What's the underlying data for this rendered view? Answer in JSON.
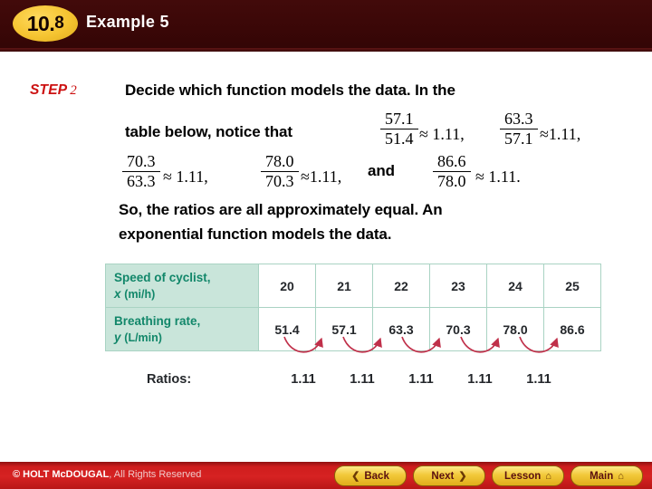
{
  "header": {
    "chapter_major": "10",
    "chapter_dot": ".",
    "chapter_minor": "8",
    "title": "Example 5"
  },
  "step": {
    "label": "STEP",
    "number": "2",
    "line1": "Decide which function models the data. In the",
    "line2": "table below, notice that",
    "and_word": "and",
    "conclusion_line1": "So, the ratios are all approximately equal. An",
    "conclusion_line2": "exponential function models the data."
  },
  "fractions": [
    {
      "id": "A1",
      "numerator": "57.1",
      "denominator": "51.4",
      "approx": "≈ 1.11,"
    },
    {
      "id": "A2",
      "numerator": "63.3",
      "denominator": "57.1",
      "approx": "≈1.11,"
    },
    {
      "id": "B1",
      "numerator": "70.3",
      "denominator": "63.3",
      "approx": "≈ 1.11,"
    },
    {
      "id": "B2",
      "numerator": "78.0",
      "denominator": "70.3",
      "approx": "≈1.11,"
    },
    {
      "id": "B3",
      "numerator": "86.6",
      "denominator": "78.0",
      "approx": "≈ 1.11."
    }
  ],
  "chart_data": {
    "type": "table",
    "title": "Speed of cyclist vs Breathing rate",
    "row_headers": [
      {
        "label": "Speed of cyclist,",
        "variable": "x",
        "unit": "(mi/h)"
      },
      {
        "label": "Breathing rate,",
        "variable": "y",
        "unit": "(L/min)"
      }
    ],
    "categories": [
      "20",
      "21",
      "22",
      "23",
      "24",
      "25"
    ],
    "series": [
      {
        "name": "Speed of cyclist, x (mi/h)",
        "values": [
          20,
          21,
          22,
          23,
          24,
          25
        ]
      },
      {
        "name": "Breathing rate, y (L/min)",
        "values": [
          51.4,
          57.1,
          63.3,
          70.3,
          78.0,
          86.6
        ]
      }
    ],
    "x_row": [
      "20",
      "21",
      "22",
      "23",
      "24",
      "25"
    ],
    "y_row": [
      "51.4",
      "57.1",
      "63.3",
      "70.3",
      "78.0",
      "86.6"
    ],
    "ratios_label": "Ratios:",
    "ratios": [
      "1.11",
      "1.11",
      "1.11",
      "1.11",
      "1.11"
    ],
    "xlabel": "Speed of cyclist, x (mi/h)",
    "ylabel": "Breathing rate, y (L/min)",
    "grid": true,
    "annotations": [
      "red curved arrows between consecutive breathing-rate values showing common ratio 1.11"
    ]
  },
  "colors": {
    "header_bar": "#3a0707",
    "badge": "#f5c431",
    "step_red": "#cc1111",
    "table_header_bg": "#c9e5da",
    "table_header_text": "#12876a",
    "table_border": "#a9d3c3",
    "arrow_red": "#c0304a",
    "footer_bar": "#d62222",
    "nav_button": "#f2c93a"
  },
  "footer": {
    "copyright_brand": "© HOLT McDOUGAL",
    "copyright_rest": ", All Rights Reserved",
    "buttons": [
      {
        "label": "Back",
        "icon": "chevron-left-icon",
        "glyph": "❮",
        "icon_side": "left"
      },
      {
        "label": "Next",
        "icon": "chevron-right-icon",
        "glyph": "❯",
        "icon_side": "right"
      },
      {
        "label": "Lesson",
        "icon": "home-icon",
        "glyph": "⌂",
        "icon_side": "right"
      },
      {
        "label": "Main",
        "icon": "home-icon",
        "glyph": "⌂",
        "icon_side": "right"
      }
    ]
  }
}
